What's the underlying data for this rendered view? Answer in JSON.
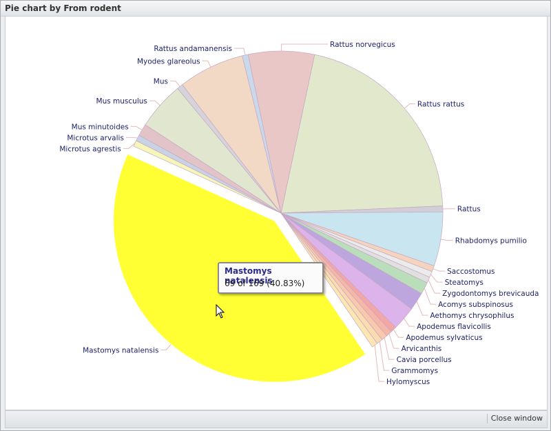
{
  "window": {
    "title": "Pie chart by From rodent",
    "close_label": "Close window"
  },
  "tooltip": {
    "title": "Mastomys natalensis",
    "value": "69 of 169 (40.83%)"
  },
  "chart_data": {
    "type": "pie",
    "total": 169,
    "highlighted": "Mastomys natalensis",
    "slices": [
      {
        "label": "Rattus rattus",
        "value": 35,
        "color": "#e2e8cc"
      },
      {
        "label": "Rattus",
        "value": 1,
        "color": "#d2ced6"
      },
      {
        "label": "Rhabdomys pumilio",
        "value": 9,
        "color": "#c9e5ef"
      },
      {
        "label": "Saccostomus",
        "value": 1,
        "color": "#f6d3bd"
      },
      {
        "label": "Steatomys",
        "value": 1,
        "color": "#ebebeb"
      },
      {
        "label": "Zygodontomys brevicauda",
        "value": 1,
        "color": "#e0e0e0"
      },
      {
        "label": "Acomys subspinosus",
        "value": 2,
        "color": "#b9deb9"
      },
      {
        "label": "Aethomys chrysophilus",
        "value": 3,
        "color": "#bca6dd"
      },
      {
        "label": "Apodemus flavicollis",
        "value": 4,
        "color": "#dcb3ea"
      },
      {
        "label": "Apodemus sylvaticus",
        "value": 1,
        "color": "#f3a6a6"
      },
      {
        "label": "Arvicanthis",
        "value": 1,
        "color": "#f7b7a7"
      },
      {
        "label": "Cavia porcellus",
        "value": 1,
        "color": "#f9c8ad"
      },
      {
        "label": "Grammomys",
        "value": 1,
        "color": "#fbdcb0"
      },
      {
        "label": "Hylomyscus",
        "value": 1,
        "color": "#fde6b2"
      },
      {
        "label": "Mastomys natalensis",
        "value": 69,
        "color": "#ffff33"
      },
      {
        "label": "Microtus agrestis",
        "value": 1,
        "color": "#f6f6b8"
      },
      {
        "label": "Microtus arvalis",
        "value": 1,
        "color": "#c9d3e6"
      },
      {
        "label": "Mus minutoides",
        "value": 2,
        "color": "#e2c4c8"
      },
      {
        "label": "Mus musculus",
        "value": 8,
        "color": "#e1e7cf"
      },
      {
        "label": "Mus",
        "value": 1,
        "color": "#d7d3db"
      },
      {
        "label": "Myodes glareolus",
        "value": 11,
        "color": "#f2d9c6"
      },
      {
        "label": "Rattus andamanensis",
        "value": 1,
        "color": "#c9d8ea"
      },
      {
        "label": "Rattus norvegicus",
        "value": 11,
        "color": "#eac7c7"
      }
    ]
  }
}
